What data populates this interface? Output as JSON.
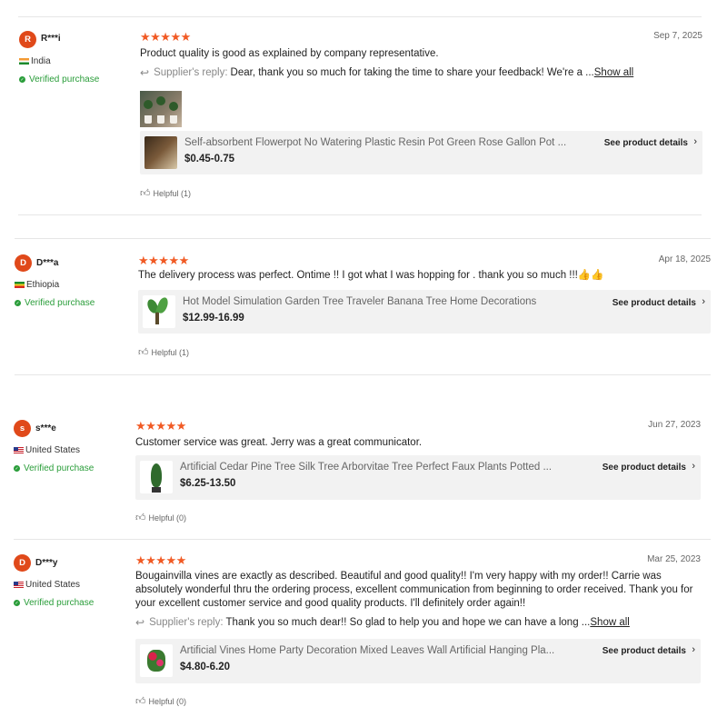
{
  "reviews": [
    {
      "avatar": "R",
      "name": "R***i",
      "country": "India",
      "verified": "Verified purchase",
      "stars": "★★★★★",
      "date": "Sep 7, 2025",
      "text": "Product quality is good as explained by company representative.",
      "reply_label": "Supplier's reply:",
      "reply_text": "Dear, thank you so much for taking the time to share your feedback! We're a ...",
      "show_all": "Show all",
      "product_title": "Self-absorbent Flowerpot No Watering Plastic Resin Pot Green Rose Gallon Pot ...",
      "product_price": "$0.45-0.75",
      "see_details": "See product details",
      "helpful": "Helpful (1)"
    },
    {
      "avatar": "D",
      "name": "D***a",
      "country": "Ethiopia",
      "verified": "Verified purchase",
      "stars": "★★★★★",
      "date": "Apr 18, 2025",
      "text": "The delivery process was perfect. Ontime !! I got what I was hopping for . thank you so much !!!👍👍",
      "product_title": "Hot Model Simulation Garden Tree Traveler Banana Tree Home Decorations",
      "product_price": "$12.99-16.99",
      "see_details": "See product details",
      "helpful": "Helpful (1)"
    },
    {
      "avatar": "s",
      "name": "s***e",
      "country": "United States",
      "verified": "Verified purchase",
      "stars": "★★★★★",
      "date": "Jun 27, 2023",
      "text": "Customer service was great. Jerry was a great communicator.",
      "product_title": "Artificial Cedar Pine Tree Silk Tree Arborvitae Tree Perfect Faux Plants Potted ...",
      "product_price": "$6.25-13.50",
      "see_details": "See product details",
      "helpful": "Helpful (0)"
    },
    {
      "avatar": "D",
      "name": "D***y",
      "country": "United States",
      "verified": "Verified purchase",
      "stars": "★★★★★",
      "date": "Mar 25, 2023",
      "text": "Bougainvilla vines are exactly as described. Beautiful and good quality!! I'm very happy with my order!! Carrie was absolutely wonderful thru the ordering process, excellent communication from beginning to order received. Thank you for your excellent customer service and good quality products. I'll definitely order again!!",
      "reply_label": "Supplier's reply:",
      "reply_text": "Thank you so much dear!! So glad to help you and hope we can have a long ...",
      "show_all": "Show all",
      "product_title": "Artificial Vines Home Party Decoration Mixed Leaves Wall Artificial Hanging Pla...",
      "product_price": "$4.80-6.20",
      "see_details": "See product details",
      "helpful": "Helpful (0)"
    }
  ],
  "colors": {
    "accent": "#f15a24",
    "verified": "#2a9d3a",
    "avatar": "#e0491a"
  }
}
